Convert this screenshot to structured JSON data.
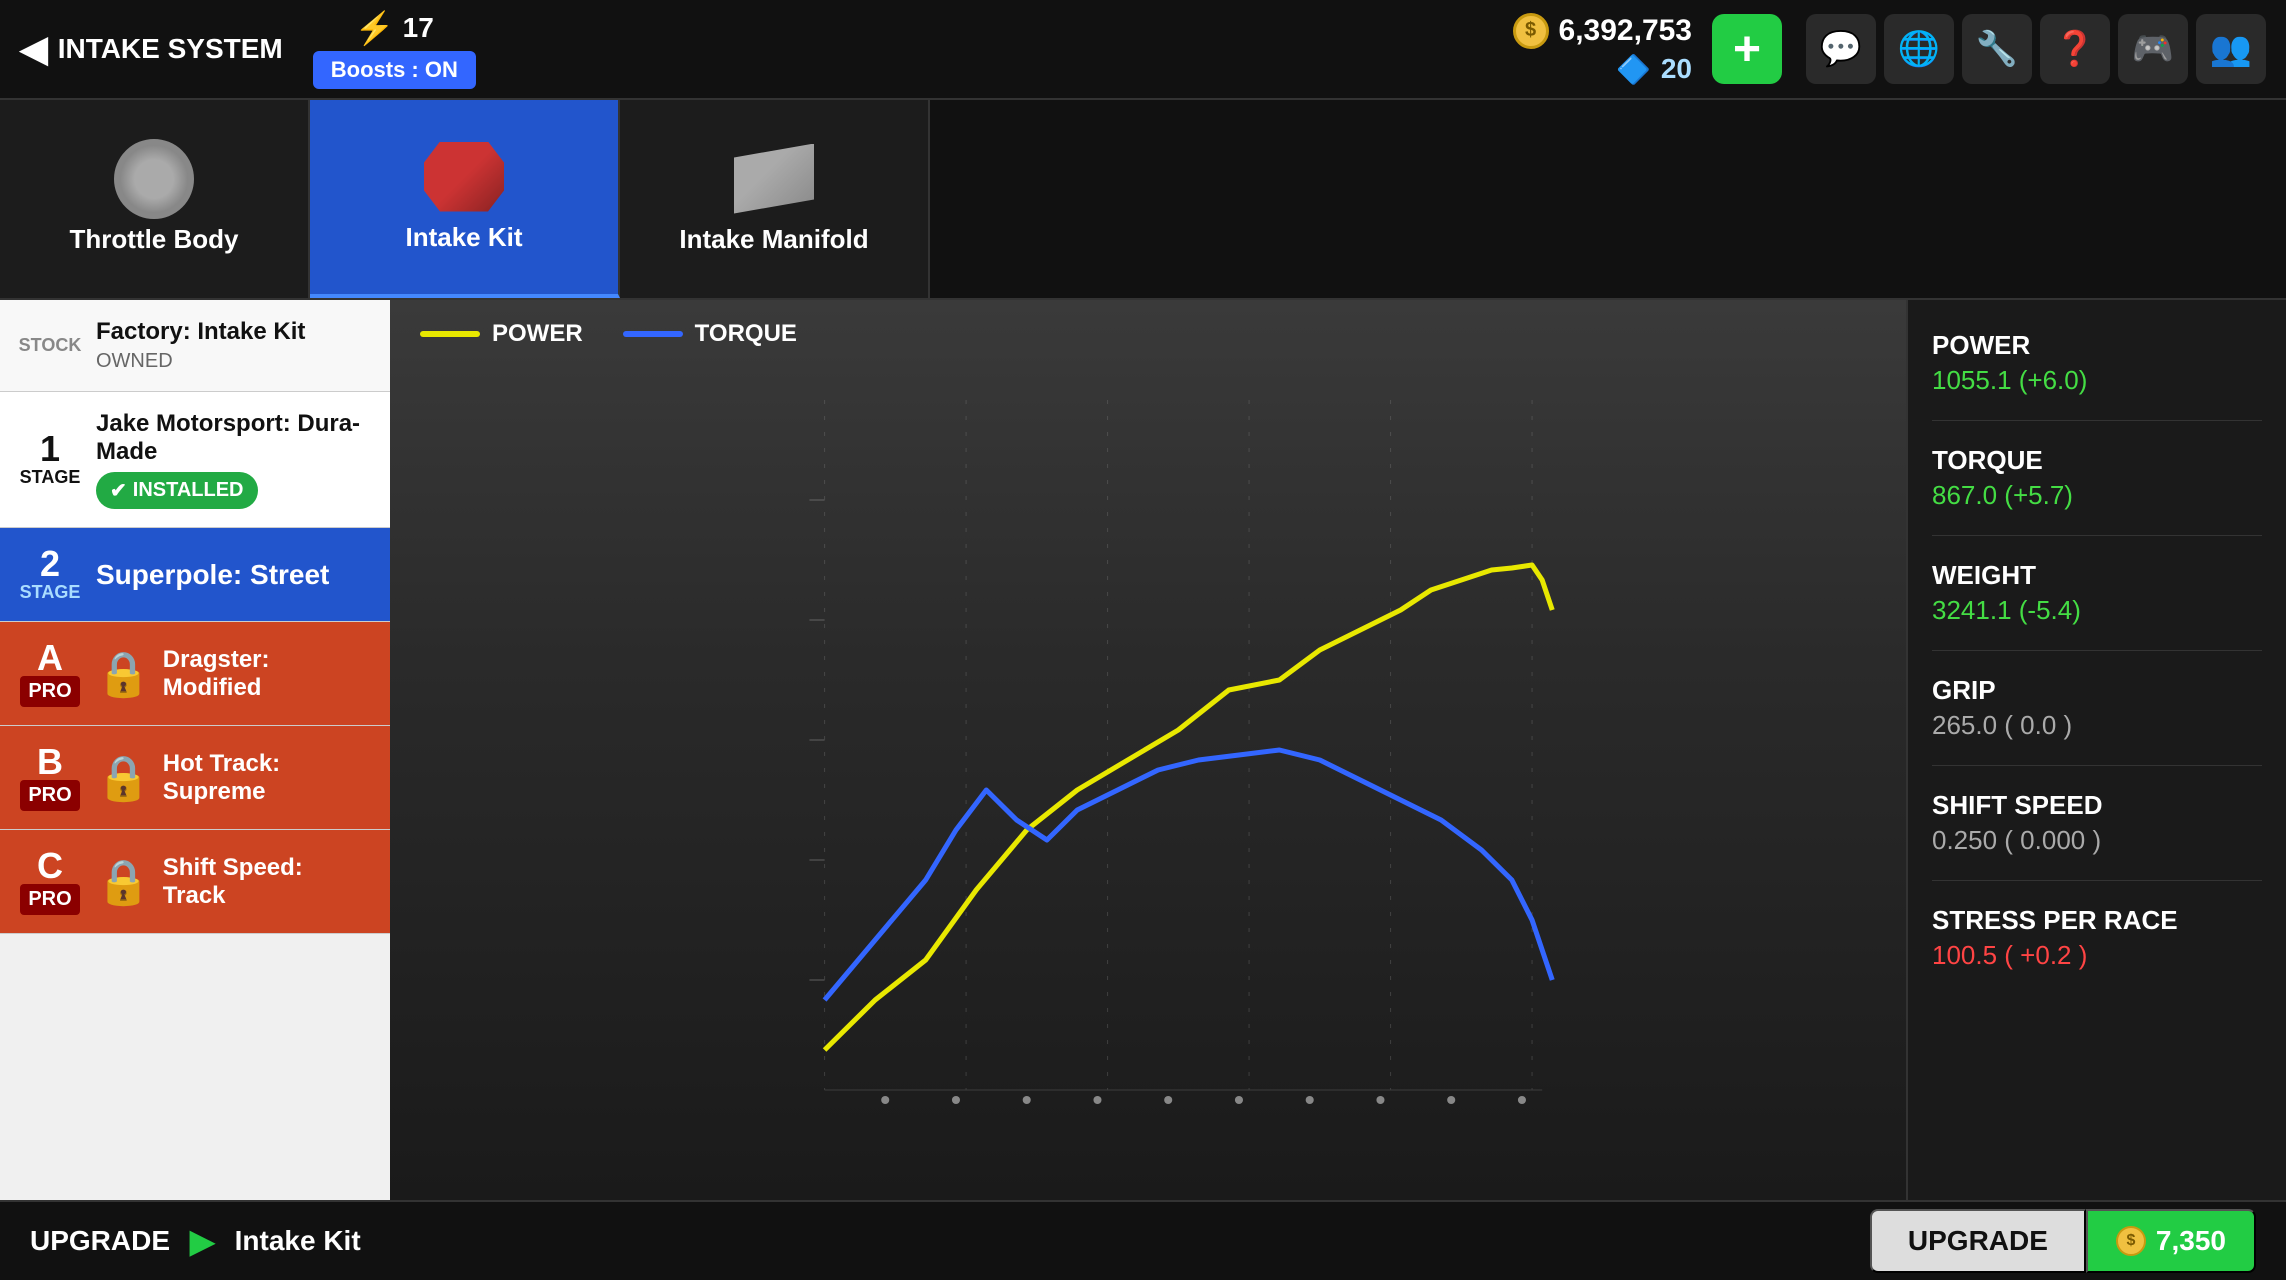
{
  "header": {
    "back_label": "INTAKE SYSTEM",
    "lightning_count": "17",
    "boosts_label": "Boosts : ON",
    "gold_amount": "6,392,753",
    "diamond_amount": "20",
    "add_label": "+",
    "icons": [
      "💬",
      "🌐",
      "🔧",
      "❓",
      "🎮",
      "👥"
    ]
  },
  "tabs": [
    {
      "id": "throttle-body",
      "label": "Throttle Body",
      "active": false
    },
    {
      "id": "intake-kit",
      "label": "Intake Kit",
      "active": true
    },
    {
      "id": "intake-manifold",
      "label": "Intake Manifold",
      "active": false
    }
  ],
  "upgrades": [
    {
      "id": "stock",
      "stage": "STOCK",
      "title": "Factory: Intake Kit",
      "subtitle": "OWNED",
      "status": "stock",
      "lock": false
    },
    {
      "id": "stage1",
      "stage_num": "1",
      "stage_text": "STAGE",
      "title": "Jake Motorsport: Dura-Made",
      "installed": true,
      "installed_label": "INSTALLED",
      "status": "installed",
      "lock": false
    },
    {
      "id": "stage2",
      "stage_num": "2",
      "stage_text": "STAGE",
      "title": "Superpole: Street",
      "status": "selected",
      "lock": false
    },
    {
      "id": "pro-a",
      "pro": "A",
      "pro_text": "PRO",
      "title": "Dragster: Modified",
      "status": "locked",
      "lock": true
    },
    {
      "id": "pro-b",
      "pro": "B",
      "pro_text": "PRO",
      "title": "Hot Track: Supreme",
      "status": "locked",
      "lock": true
    },
    {
      "id": "pro-c",
      "pro": "C",
      "pro_text": "PRO",
      "title": "Shift Speed: Track",
      "status": "locked",
      "lock": true
    }
  ],
  "chart": {
    "power_label": "POWER",
    "torque_label": "TORQUE"
  },
  "stats": [
    {
      "id": "power",
      "label": "POWER",
      "value": "1055.1 (+6.0)",
      "type": "positive"
    },
    {
      "id": "torque",
      "label": "TORQUE",
      "value": "867.0 (+5.7)",
      "type": "positive"
    },
    {
      "id": "weight",
      "label": "WEIGHT",
      "value": "3241.1 (-5.4)",
      "type": "positive"
    },
    {
      "id": "grip",
      "label": "GRIP",
      "value": "265.0 ( 0.0 )",
      "type": "neutral"
    },
    {
      "id": "shift-speed",
      "label": "SHIFT SPEED",
      "value": "0.250 ( 0.000 )",
      "type": "neutral"
    },
    {
      "id": "stress",
      "label": "STRESS PER RACE",
      "value": "100.5 ( +0.2 )",
      "type": "negative"
    }
  ],
  "bottom_bar": {
    "upgrade_label": "UPGRADE",
    "part_name": "Intake Kit",
    "upgrade_btn_label": "UPGRADE",
    "cost": "7,350"
  }
}
